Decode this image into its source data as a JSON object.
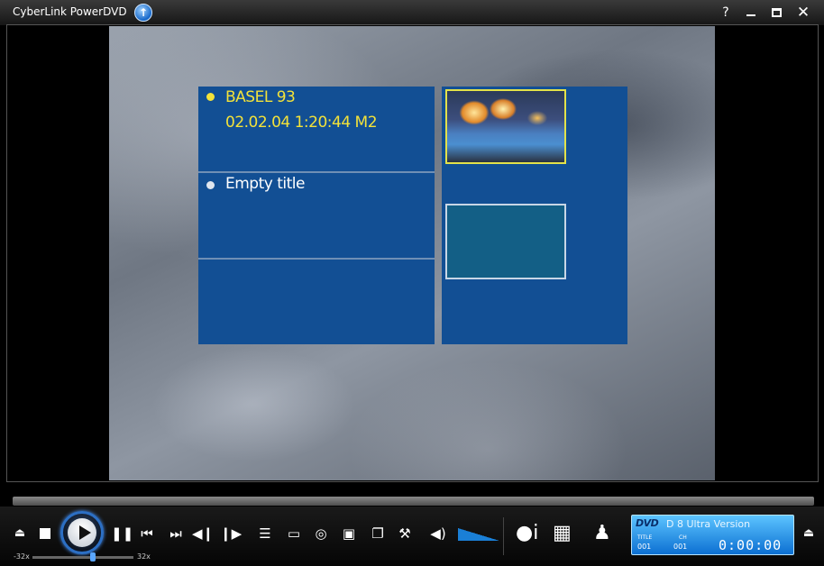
{
  "window": {
    "title": "CyberLink PowerDVD",
    "upgrade_icon": "↑",
    "help_label": "?",
    "close_label": "✕"
  },
  "dvd_menu": {
    "title_1": {
      "name": "BASEL 93",
      "date": "02.02.04 1:20:44 M2"
    },
    "title_2": {
      "name": "Empty title"
    }
  },
  "controls": {
    "eject_icon": "⏏",
    "pause_icon": "❚❚",
    "prev_icon": "⏮",
    "next_icon": "⏭",
    "step_back_icon": "◀❙",
    "step_forward_icon": "❙▶",
    "chapters_icon": "☰",
    "subtitles_icon": "▭",
    "language_icon": "◎",
    "snapshot_icon": "▣",
    "zoom_icon": "❐",
    "settings_icon": "⚒",
    "volume_icon": "◀)",
    "info_icon": "●i",
    "media_icon": "▦",
    "dvd_menu_icon": "♟",
    "collapse_icon": "⏏",
    "speed_min": "-32x",
    "speed_max": "32x"
  },
  "status": {
    "logo": "DVD",
    "version": "D 8 Ultra Version",
    "title_label": "TITLE",
    "chapter_label": "CH",
    "title_number": "001",
    "chapter_number": "001",
    "time": "0:00:00"
  },
  "colors": {
    "menu_panel": "#124f94",
    "selected_text": "#f3e23a",
    "accent": "#2c6fc4"
  }
}
